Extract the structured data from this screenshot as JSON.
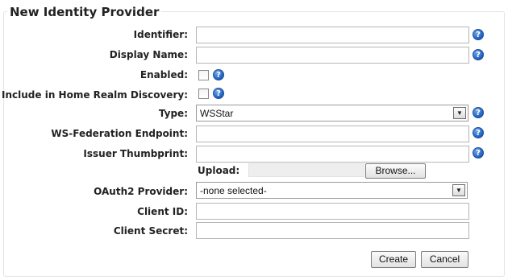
{
  "form": {
    "title": "New Identity Provider",
    "fields": {
      "identifier": {
        "label": "Identifier:",
        "value": ""
      },
      "display_name": {
        "label": "Display Name:",
        "value": ""
      },
      "enabled": {
        "label": "Enabled:",
        "checked": false
      },
      "home_realm": {
        "label": "Include in Home Realm Discovery:",
        "checked": false
      },
      "type": {
        "label": "Type:",
        "value": "WSStar"
      },
      "ws_fed_endpoint": {
        "label": "WS-Federation Endpoint:",
        "value": ""
      },
      "issuer_thumbprint": {
        "label": "Issuer Thumbprint:",
        "value": ""
      },
      "upload": {
        "label": "Upload:",
        "browse_label": "Browse..."
      },
      "oauth2_provider": {
        "label": "OAuth2 Provider:",
        "value": "-none selected-"
      },
      "client_id": {
        "label": "Client ID:",
        "value": ""
      },
      "client_secret": {
        "label": "Client Secret:",
        "value": ""
      }
    },
    "help_glyph": "?",
    "dropdown_glyph": "▼",
    "create_label": "Create",
    "cancel_label": "Cancel"
  },
  "icons": {
    "help": "help-icon",
    "dropdown": "chevron-down-icon"
  },
  "colors": {
    "help_icon": "#1d5fbf",
    "border": "#b6b6b6"
  }
}
